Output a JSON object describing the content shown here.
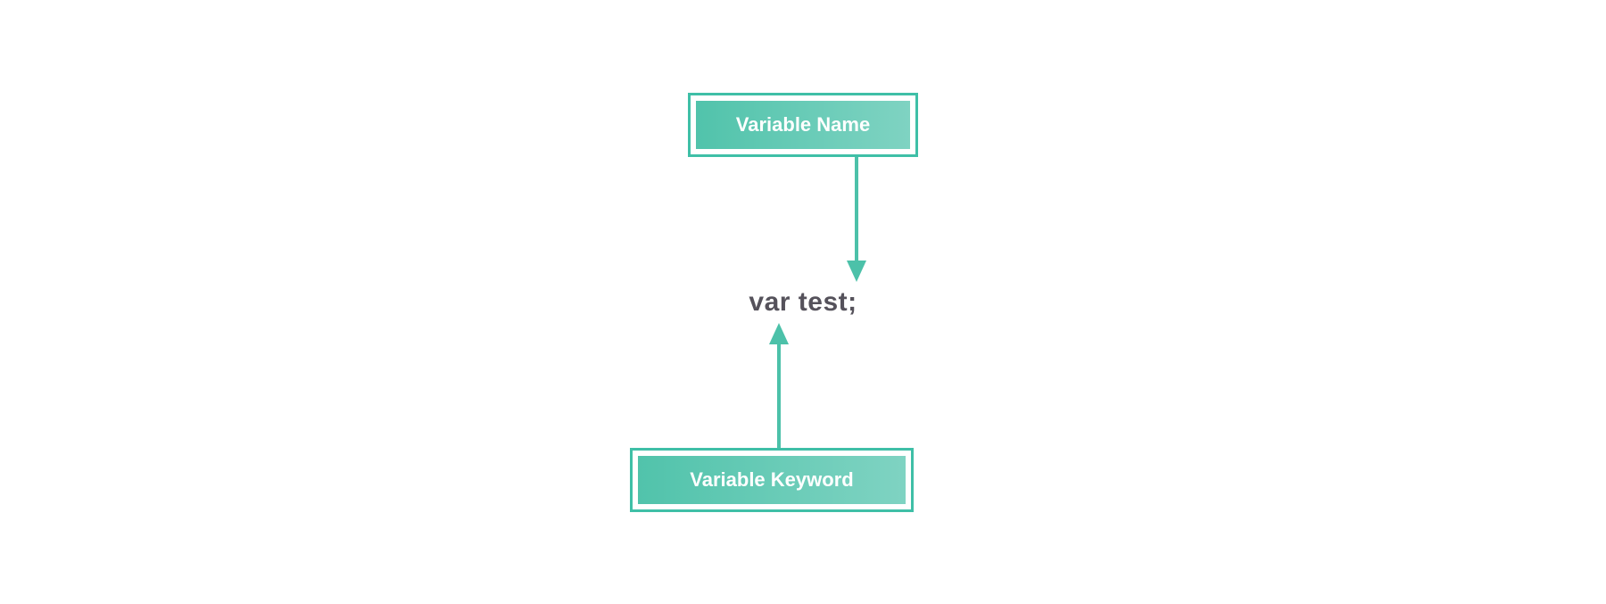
{
  "boxes": {
    "top": "Variable Name",
    "bottom": "Variable Keyword"
  },
  "code": "var test;",
  "colors": {
    "accent": "#4cc1a9",
    "boxGradientStart": "#51c3ab",
    "boxGradientEnd": "#7fd3c2",
    "codeText": "#55525b"
  }
}
